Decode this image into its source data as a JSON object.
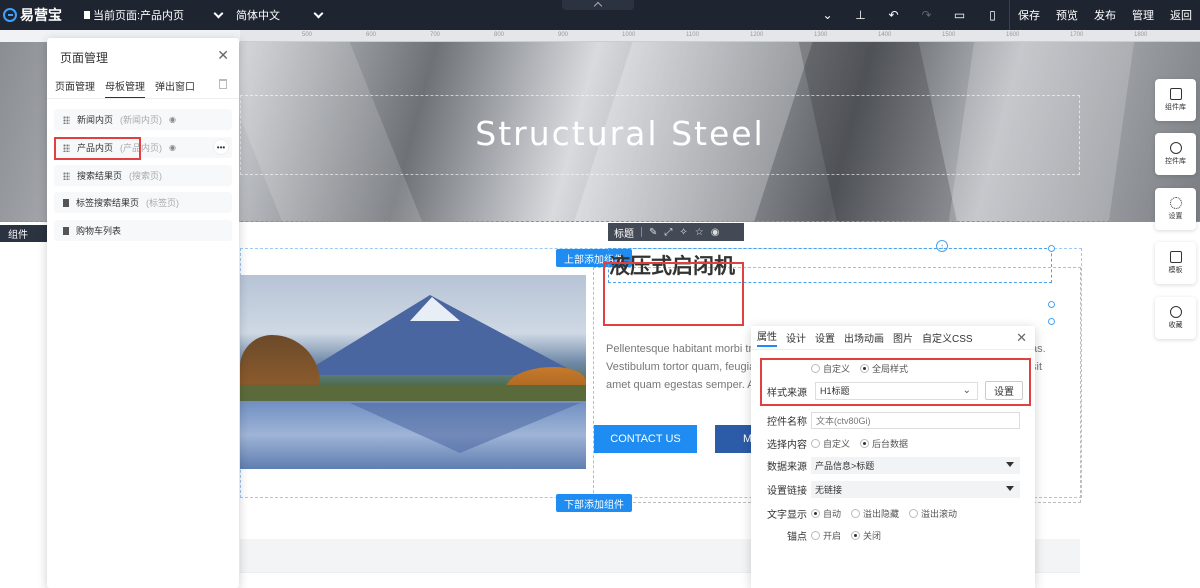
{
  "topbar": {
    "logo_text": "易营宝",
    "current_page": "当前页面:产品内页",
    "language": "简体中文",
    "buttons": {
      "save": "保存",
      "preview": "预览",
      "publish": "发布",
      "manage": "管理",
      "back": "返回"
    }
  },
  "ruler": {
    "ticks": [
      "500",
      "600",
      "700",
      "800",
      "900",
      "1000",
      "1100",
      "1200",
      "1300",
      "1400",
      "1500",
      "1600",
      "1700",
      "1800",
      "1900"
    ]
  },
  "canvas": {
    "banner_title": "Structural Steel",
    "component_strip_label": "组件",
    "add_top": "上部添加组件",
    "add_bottom": "下部添加组件",
    "product_title": "液压式启闭机",
    "body_line1": "Pellentesque habitant morbi tr",
    "body_line2": "Vestibulum tortor quam, feugia",
    "body_line3": "amet quam egestas semper. Ae",
    "body_right1": "as.",
    "body_right2": "sit",
    "contact_button": "CONTACT US",
    "more_button": "M"
  },
  "title_toolbar": {
    "label": "标题"
  },
  "props": {
    "tabs": [
      "属性",
      "设计",
      "设置",
      "出场动画",
      "图片",
      "自定义CSS"
    ],
    "style_source_label": "样式来源",
    "style_custom": "自定义",
    "style_global": "全局样式",
    "style_value": "H1标题",
    "set_button": "设置",
    "name_label": "控件名称",
    "name_value": "文本(ctv80Gi)",
    "content_label": "选择内容",
    "content_custom": "自定义",
    "content_backend": "后台数据",
    "source_label": "数据来源",
    "source_value": "产品信息>标题",
    "link_label": "设置链接",
    "link_value": "无链接",
    "display_label": "文字显示",
    "display_auto": "自动",
    "display_hide": "溢出隐藏",
    "display_scroll": "溢出滚动",
    "anchor_label": "锚点",
    "anchor_on": "开启",
    "anchor_off": "关闭"
  },
  "side_buttons": [
    "组件库",
    "控件库",
    "设置",
    "模板",
    "收藏"
  ],
  "page_panel": {
    "title": "页面管理",
    "tabs": [
      "页面管理",
      "母板管理",
      "弹出窗口"
    ],
    "items": [
      {
        "name": "新闻内页",
        "sub": "(新闻内页)"
      },
      {
        "name": "产品内页",
        "sub": "(产品内页)"
      },
      {
        "name": "搜索结果页",
        "sub": "(搜索页)"
      },
      {
        "name": "标签搜索结果页",
        "sub": "(标签页)"
      },
      {
        "name": "购物车列表",
        "sub": ""
      }
    ]
  },
  "colors": {
    "accent": "#1e8cf0",
    "toolbar_bg": "#1f2530",
    "highlight_red": "#e04040"
  }
}
